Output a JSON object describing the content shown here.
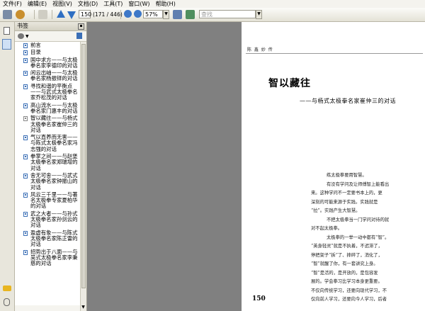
{
  "menu": [
    "文件(F)",
    "编辑(E)",
    "视图(V)",
    "文档(D)",
    "工具(T)",
    "窗口(W)",
    "帮助(H)"
  ],
  "toolbar": {
    "page_number": "150",
    "page_count": "(171 / 446)",
    "zoom": "57%",
    "search_placeholder": "查找"
  },
  "bookmarks": {
    "title": "书签",
    "items": [
      {
        "label": "前言"
      },
      {
        "label": "目录"
      },
      {
        "label": "国中求方——与太极拳名家李德印的对话"
      },
      {
        "label": "闲云出岫——与太极拳名家杨振铎的对话"
      },
      {
        "label": "寻找和谐的平衡点——与武式太极拳名家乔松茂的对话"
      },
      {
        "label": "高山流水——与太极拳名家门惠丰的对话"
      },
      {
        "label": "智以藏往——与杨式太极拳名家崔仲三的对话",
        "active": true
      },
      {
        "label": "气以直养而无害——与陈式太极拳名家冯志强的对话"
      },
      {
        "label": "拳掌之间——与赵堡太极拳名家郑瑞增的对话"
      },
      {
        "label": "舍无可舍——与武式太极拳名家钟振山的对话"
      },
      {
        "label": "风云三千里——与著名太极拳专家夏柏华的对话"
      },
      {
        "label": "武之大者——与孙式太极拳名家孙剑云的对话"
      },
      {
        "label": "盈虚有象——与陈式太极拳名家陈正雷的对话"
      },
      {
        "label": "招势出于八面——与吴式太极拳名家李秉慈的对话"
      }
    ]
  },
  "page": {
    "header": "陈 鑫 妙 传",
    "title": "智以藏往",
    "subtitle": "——与杨式太极拳名家崔仲三的对话",
    "paragraphs": [
      "练太极拳要用智慧。",
      "有没有学问及让师傅智上能看出",
      "来。这种学问不一定要书本上的，更",
      "深刻的可能来源于实践。实践就是",
      "“拉”。实践产生大智慧。",
      "不把太极拳当一门学问对待的就",
      "对不起太极拳。",
      "太极拳的一举一动中都有“智”。",
      "“英身轻灵”就是不执着，不迟滞了，",
      "停把架子“拆”了、摔碎了，消化了，",
      "“智”就醒了你，有一套讲究上身。",
      "“智”是活的，是开放的，是包容发",
      "展的。学会拳习比学习本身更重要。",
      "不仅向传统学习，还要向现代学习，不",
      "仅向前人学习，还要向今人学习，后者"
    ],
    "page_number": "150"
  }
}
